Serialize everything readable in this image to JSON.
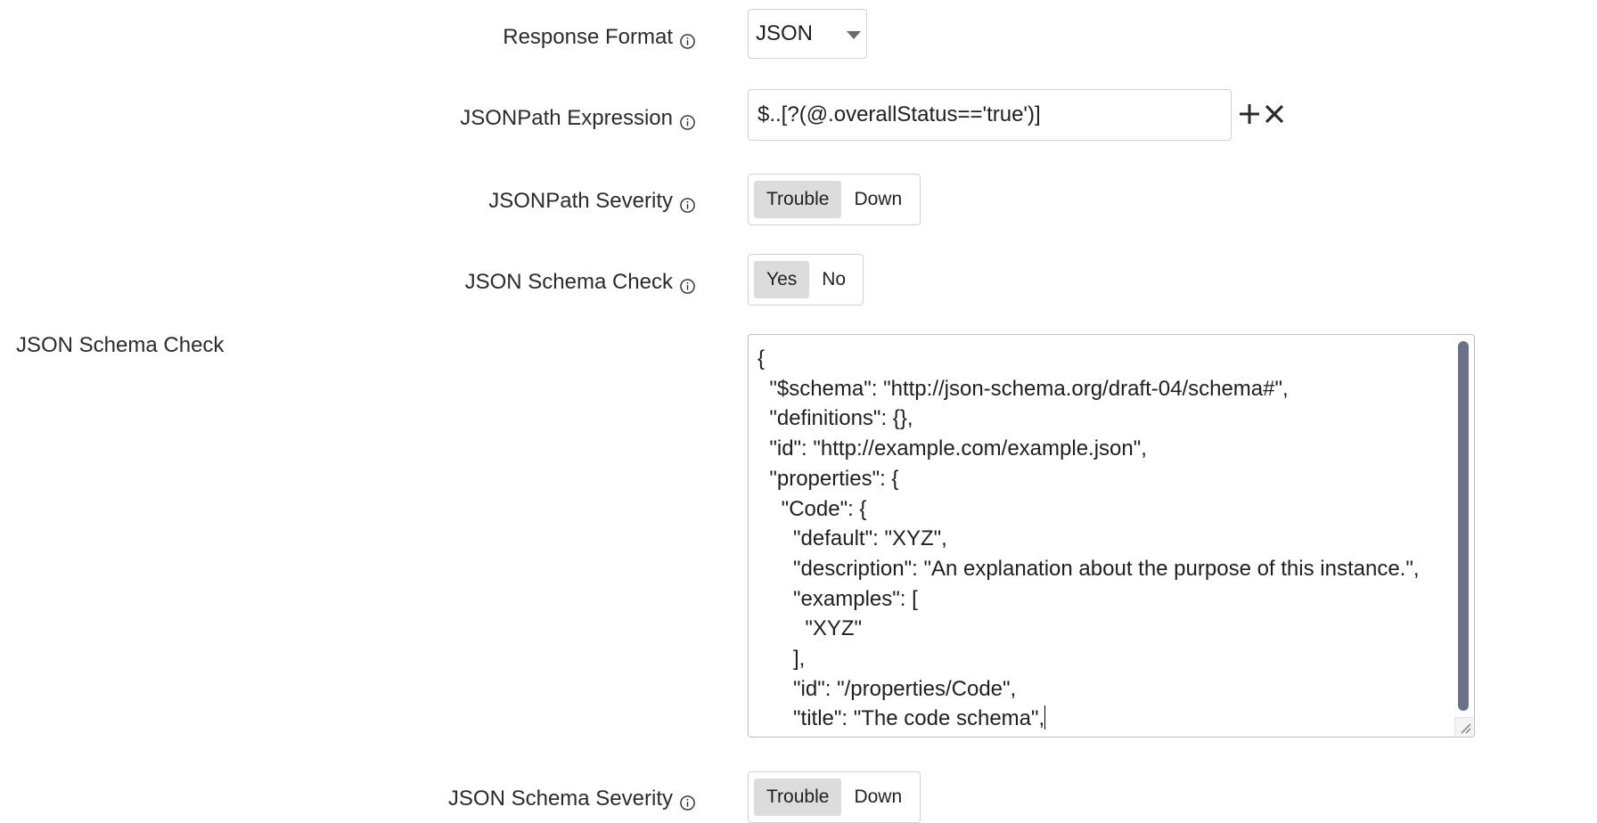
{
  "fields": {
    "response_format": {
      "label": "Response Format",
      "value": "JSON"
    },
    "jsonpath_expression": {
      "label": "JSONPath Expression",
      "value": "$..[?(@.overallStatus=='true')]"
    },
    "jsonpath_severity": {
      "label": "JSONPath Severity",
      "options": [
        "Trouble",
        "Down"
      ],
      "selected": "Trouble"
    },
    "json_schema_check_toggle": {
      "label": "JSON Schema Check",
      "options": [
        "Yes",
        "No"
      ],
      "selected": "Yes"
    },
    "json_schema_editor": {
      "label": "JSON Schema Check",
      "lines": [
        "{",
        "  \"$schema\": \"http://json-schema.org/draft-04/schema#\",",
        "  \"definitions\": {},",
        "  \"id\": \"http://example.com/example.json\",",
        "  \"properties\": {",
        "    \"Code\": {",
        "      \"default\": \"XYZ\",",
        "      \"description\": \"An explanation about the purpose of this instance.\",",
        "      \"examples\": [",
        "        \"XYZ\"",
        "      ],",
        "      \"id\": \"/properties/Code\",",
        "      \"title\": \"The code schema\","
      ]
    },
    "json_schema_severity": {
      "label": "JSON Schema Severity",
      "options": [
        "Trouble",
        "Down"
      ],
      "selected": "Trouble"
    }
  },
  "icons": {
    "info": "info-icon",
    "add": "plus-icon",
    "remove": "close-icon",
    "dropdown": "caret-down-icon"
  },
  "colors": {
    "border": "#cfd3d8",
    "active_segment": "#dcdcdc",
    "scrollbar": "#6b7187",
    "icon": "#2b2b2b"
  }
}
